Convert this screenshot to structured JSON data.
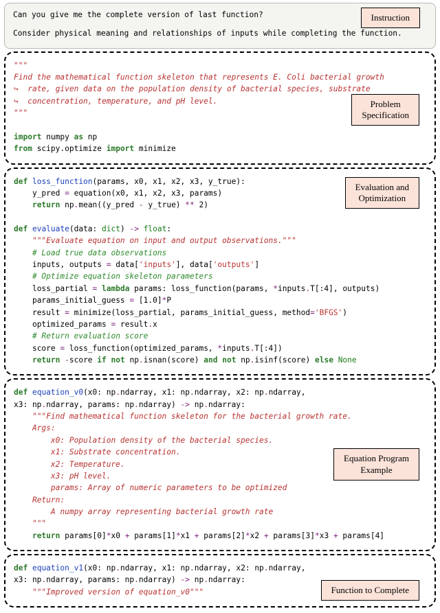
{
  "labels": {
    "instruction": "Instruction",
    "problem_spec": "Problem\nSpecification",
    "eval_opt": "Evaluation and\nOptimization",
    "eq_example": "Equation Program\nExample",
    "to_complete": "Function to Complete"
  },
  "instruction": {
    "line1": "Can you give me the complete version of last function?",
    "line2": "Consider physical meaning and relationships of inputs while completing the function."
  },
  "spec": {
    "triple": "\"\"\"",
    "l1": "Find the mathematical function skeleton that represents E. Coli bacterial growth",
    "l2": "rate, given data on the population density of bacterial species, substrate",
    "l3": "concentration, temperature, and pH level.",
    "hook": "↪  ",
    "imp_np": {
      "kw": "import",
      "mid": " numpy ",
      "as": "as",
      "np": " np"
    },
    "imp_sc": {
      "from": "from",
      "pkg": " scipy.optimize ",
      "imp": "import",
      "what": " minimize"
    }
  },
  "eval": {
    "def": "def",
    "loss_name": "loss_function",
    "loss_sig": "(params, x0, x1, x2, x3, y_true):",
    "loss_b1a": "    y_pred ",
    "loss_b1b": " equation(x0, x1, x2, x3, params)",
    "loss_ret": "return",
    "loss_b2a": " np",
    "loss_b2b": "mean((y_pred ",
    "loss_b2c": " y_true) ",
    "loss_b2d": " 2)",
    "ev_name": "evaluate",
    "ev_sig_a": "(data: ",
    "ev_sig_b": "dict",
    "ev_sig_c": ") ",
    "ev_sig_d": "float",
    "ev_sig_e": ":",
    "doc": "\"\"\"Evaluate equation on input and output observations.\"\"\"",
    "c_load": "# Load true data observations",
    "io_a": "    inputs, outputs ",
    "io_b": " data[",
    "io_s1": "'inputs'",
    "io_c": "], data[",
    "io_s2": "'outputs'",
    "io_d": "]",
    "c_opt": "# Optimize equation skeleton parameters",
    "lp_a": "    loss_partial ",
    "lp_b": " ",
    "lp_lambda": "lambda",
    "lp_c": " params: loss_function(params, ",
    "lp_d": "inputs",
    "lp_e": "T[:4], outputs)",
    "pig_a": "    params_initial_guess ",
    "pig_b": " [1.0]",
    "pig_c": "P",
    "res_a": "    result ",
    "res_b": " minimize(loss_partial, params_initial_guess, method",
    "res_c": "'BFGS'",
    "res_d": ")",
    "opx_a": "    optimized_params ",
    "opx_b": " result",
    "opx_c": "x",
    "c_ret": "# Return evaluation score",
    "sc_a": "    score ",
    "sc_b": " loss_function(optimized_params, ",
    "sc_c": "inputs",
    "sc_d": "T[:4])",
    "fr_a": "return ",
    "fr_b": "score ",
    "fr_if": "if",
    "fr_not": "not",
    "fr_c": " np",
    "fr_d": "isnan(score) ",
    "fr_and": "and",
    "fr_e": "isinf(score) ",
    "fr_else": "else",
    "fr_none": "None",
    "eq": "=",
    "star": "*",
    "dstar": "**",
    "minus": "-",
    "dot": ".",
    "arrow": "->"
  },
  "eqp": {
    "def": "def",
    "name": "equation_v0",
    "sig1_a": "(x0: np",
    "sig1_b": "ndarray, x1: np",
    "sig1_c": "ndarray, x2: np",
    "sig1_d": "ndarray,",
    "sig2_a": "x3: np",
    "sig2_b": "ndarray, params: np",
    "sig2_c": "ndarray) ",
    "sig2_d": " np",
    "sig2_e": "ndarray:",
    "doc": "\"\"\"Find mathematical function skeleton for the bacterial growth rate.",
    "args": "Args:",
    "a0": "x0: Population density of the bacterial species.",
    "a1": "x1: Substrate concentration.",
    "a2": "x2: Temperature.",
    "a3": "x3: pH level.",
    "ap": "params: Array of numeric parameters to be optimized",
    "ret": "Return:",
    "r1": "A numpy array representing bacterial growth rate",
    "triple": "\"\"\"",
    "retkw": "return",
    "body_a": " params[0]",
    "body_b": "x0 ",
    "body_c": " params[1]",
    "body_d": "x1 ",
    "body_e": " params[2]",
    "body_f": "x2 ",
    "body_g": " params[3]",
    "body_h": "x3 ",
    "body_i": " params[4]",
    "star": "*",
    "plus": "+",
    "dot": ".",
    "arrow": "->"
  },
  "comp": {
    "def": "def",
    "name": "equation_v1",
    "sig1_a": "(x0: np",
    "sig1_b": "ndarray, x1: np",
    "sig1_c": "ndarray, x2: np",
    "sig1_d": "ndarray,",
    "sig2_a": "x3: np",
    "sig2_b": "ndarray, params: np",
    "sig2_c": "ndarray) ",
    "sig2_d": " np",
    "sig2_e": "ndarray:",
    "doc": "\"\"\"Improved version of equation_v0\"\"\"",
    "dot": ".",
    "arrow": "->"
  }
}
